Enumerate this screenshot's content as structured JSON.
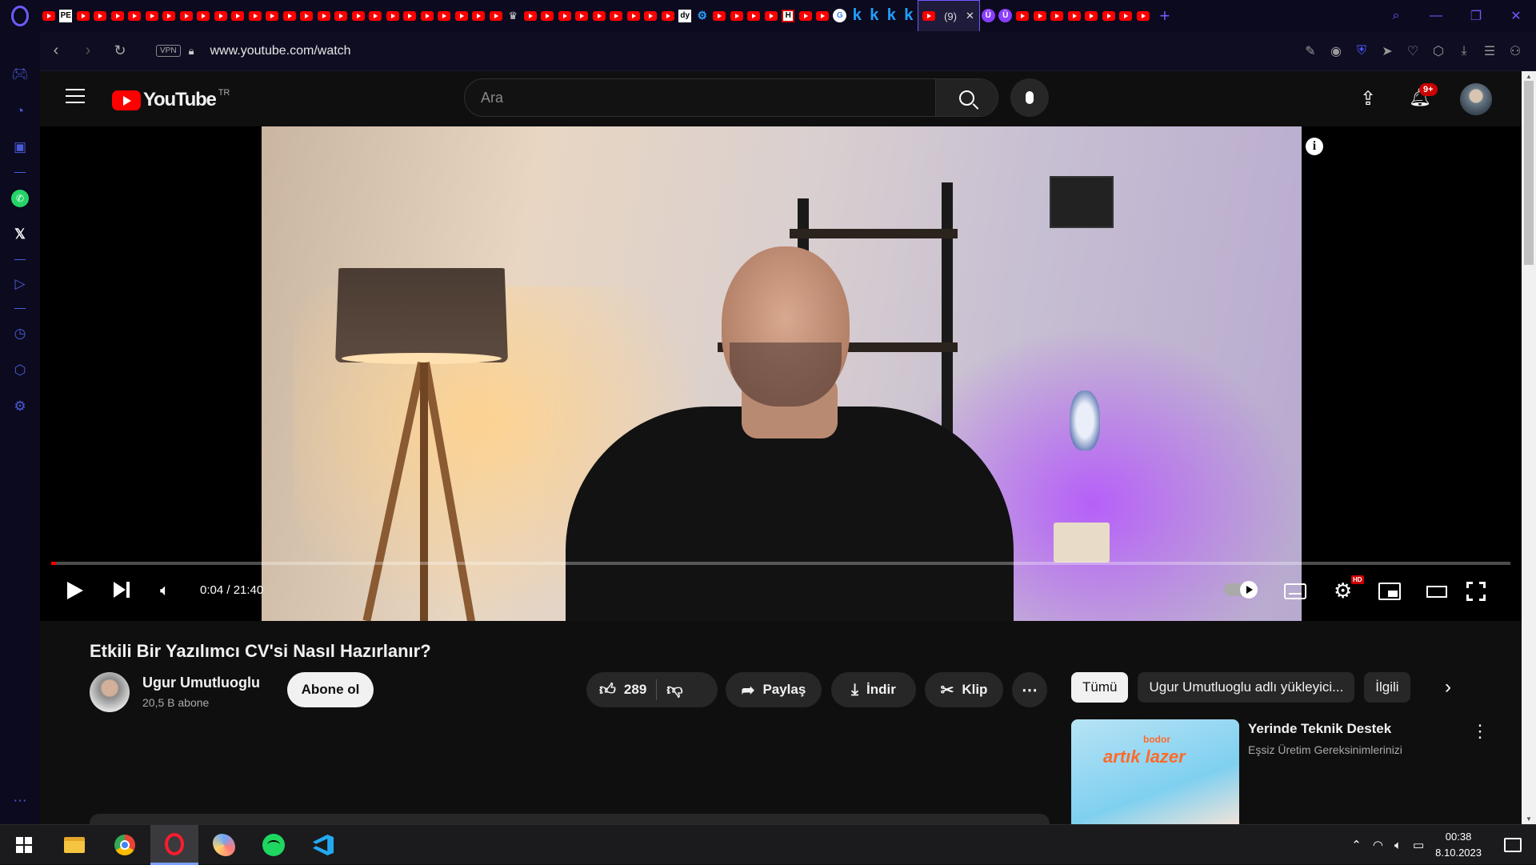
{
  "browser": {
    "active_tab_label": "(9)",
    "url": "www.youtube.com/watch",
    "vpn_label": "VPN",
    "tab_texts": {
      "pe": "PE",
      "dy": "dy",
      "h": "H",
      "g": "G",
      "k": "k",
      "u": "Ü"
    }
  },
  "youtube": {
    "logo_text": "YouTube",
    "country_code": "TR",
    "search_placeholder": "Ara",
    "notification_count": "9+",
    "video": {
      "time": "0:04 / 21:40",
      "progress_fraction": 0.0031,
      "hd_badge": "HD",
      "info_glyph": "i"
    },
    "title": "Etkili Bir Yazılımcı CV'si Nasıl Hazırlanır?",
    "channel": {
      "name": "Ugur Umutluoglu",
      "subscribers": "20,5 B abone",
      "subscribe_label": "Abone ol"
    },
    "actions": {
      "likes": "289",
      "share": "Paylaş",
      "download": "İndir",
      "clip": "Klip",
      "more": "⋯"
    },
    "chips": [
      "Tümü",
      "Ugur Umutluoglu adlı yükleyici...",
      "İlgili"
    ],
    "recommendation": {
      "title": "Yerinde Teknik Destek",
      "subtitle": "Eşsiz Üretim Gereksinimlerinizi",
      "thumb_brand": "bodor",
      "thumb_text": "artık lazer"
    }
  },
  "taskbar": {
    "time": "00:38",
    "date": "8.10.2023"
  },
  "colors": {
    "youtube_red": "#ff0000",
    "opera_accent": "#6b5cff",
    "page_bg": "#0f0f0f"
  }
}
